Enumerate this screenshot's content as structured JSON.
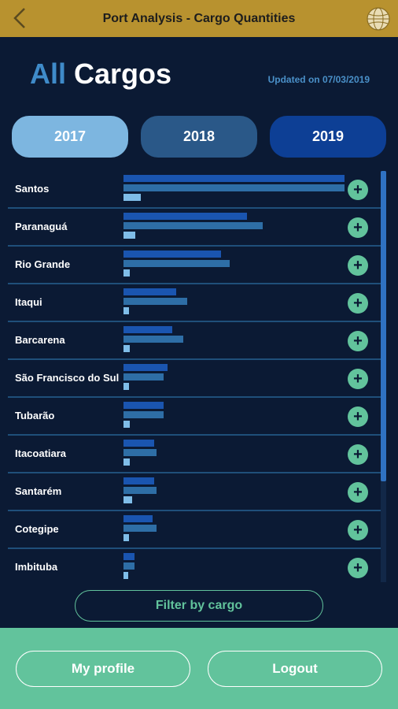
{
  "header": {
    "title": "Port Analysis - Cargo Quantities",
    "back_icon": "chevron-left-icon",
    "logo_icon": "globe-logo-icon"
  },
  "main": {
    "heading_prefix": "All",
    "heading_rest": "Cargos",
    "updated": "Updated on 07/03/2019",
    "years": [
      "2017",
      "2018",
      "2019"
    ],
    "filter_label": "Filter by cargo"
  },
  "colors": {
    "topbar": "#b8922f",
    "background": "#0b1a34",
    "accent_green": "#62c39c",
    "bar_2017": "#7fbde8",
    "bar_2018": "#2e6ea6",
    "bar_2019": "#1a55b0"
  },
  "ports": [
    {
      "name": "Santos",
      "v2019": 1.0,
      "v2018": 1.0,
      "v2017": 0.08
    },
    {
      "name": "Paranaguá",
      "v2019": 0.56,
      "v2018": 0.63,
      "v2017": 0.055
    },
    {
      "name": "Rio Grande",
      "v2019": 0.44,
      "v2018": 0.48,
      "v2017": 0.03
    },
    {
      "name": "Itaqui",
      "v2019": 0.24,
      "v2018": 0.29,
      "v2017": 0.025
    },
    {
      "name": "Barcarena",
      "v2019": 0.22,
      "v2018": 0.27,
      "v2017": 0.03
    },
    {
      "name": "São Francisco do Sul",
      "v2019": 0.2,
      "v2018": 0.18,
      "v2017": 0.025
    },
    {
      "name": "Tubarão",
      "v2019": 0.18,
      "v2018": 0.18,
      "v2017": 0.03
    },
    {
      "name": "Itacoatiara",
      "v2019": 0.14,
      "v2018": 0.15,
      "v2017": 0.03
    },
    {
      "name": "Santarém",
      "v2019": 0.14,
      "v2018": 0.15,
      "v2017": 0.04
    },
    {
      "name": "Cotegipe",
      "v2019": 0.13,
      "v2018": 0.15,
      "v2017": 0.025
    },
    {
      "name": "Imbituba",
      "v2019": 0.05,
      "v2018": 0.05,
      "v2017": 0.02
    }
  ],
  "footer": {
    "profile_label": "My profile",
    "logout_label": "Logout"
  },
  "expand_icon_glyph": "+"
}
